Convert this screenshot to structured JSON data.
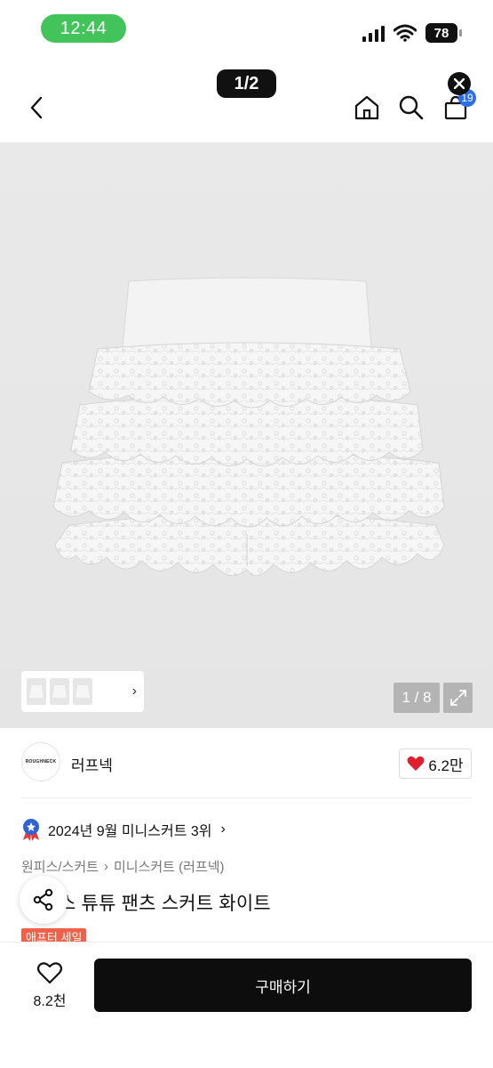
{
  "status_bar": {
    "time": "12:44",
    "battery": "78",
    "time_pill_color": "#43c45a"
  },
  "image_pill": "1/2",
  "header": {
    "back_icon": "chevron-left-icon",
    "home_icon": "home-icon",
    "search_icon": "search-icon",
    "cart_icon": "shopping-bag-icon",
    "cart_badge": "19",
    "badge_color": "#2b6ee6"
  },
  "gallery": {
    "counter": "1 / 8",
    "thumb_arrow": "›"
  },
  "brand": {
    "logo_text": "ROUGHNECK",
    "name": "러프넥",
    "likes": "6.2만",
    "heart_color": "#e0202e"
  },
  "ranking": {
    "text": "2024년 9월 미니스커트 3위",
    "chevron": "›"
  },
  "breadcrumb": {
    "category": "원피스/스커트",
    "separator": "›",
    "subcategory": "미니스커트 (러프넥)"
  },
  "product": {
    "title": "스 튜튜 팬츠 스커트 화이트",
    "sale_tag": "애프터 세일",
    "sale_color": "#f0604a"
  },
  "bottom_bar": {
    "wish_count": "8.2천",
    "buy_label": "구매하기"
  }
}
